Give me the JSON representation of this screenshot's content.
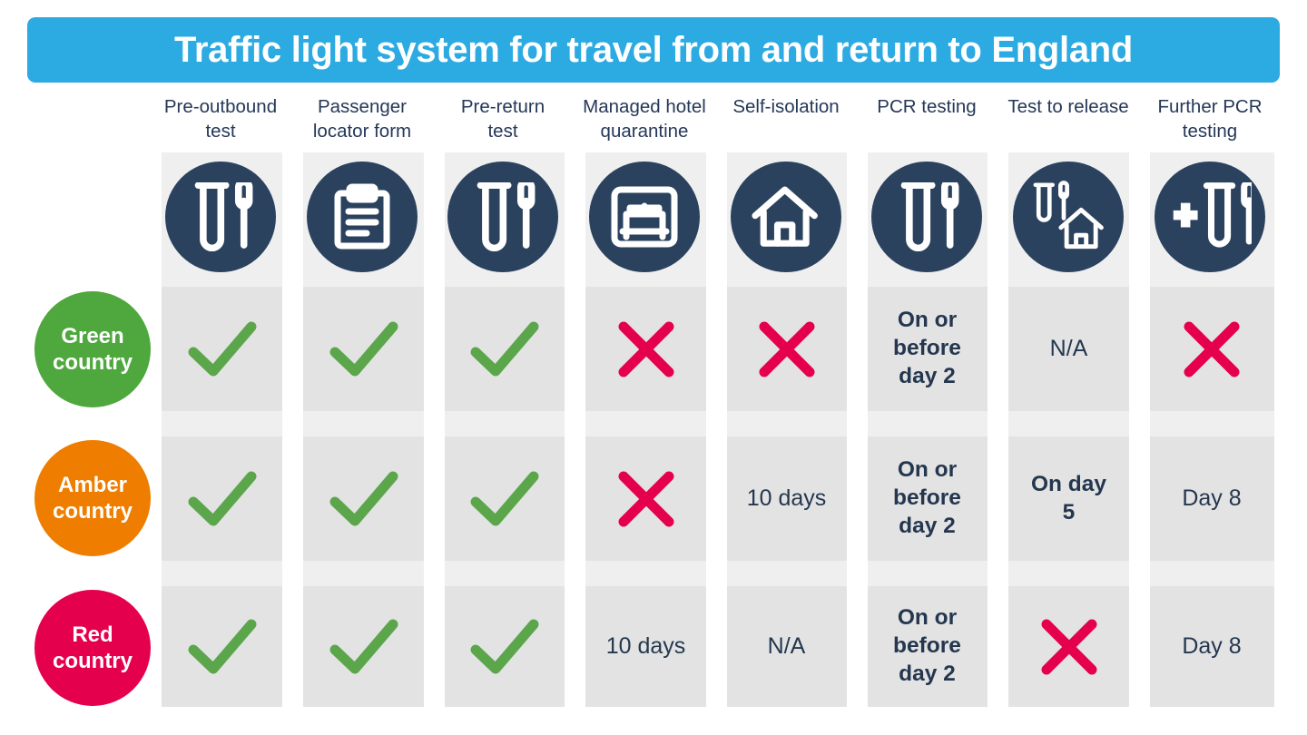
{
  "header": {
    "title": "Traffic light system for travel from and return to England",
    "title_bar_color": "#2CAAE2"
  },
  "colors": {
    "icon_circle": "#2B425F",
    "green": "#4FA83D",
    "amber": "#EE7D00",
    "red": "#E5004E",
    "check": "#5BA64B",
    "cross": "#E5004E",
    "cell_band": "#e3e3e3",
    "column_band": "#efefef",
    "text": "#24374F"
  },
  "columns": [
    {
      "label": "Pre-outbound\ntest",
      "line1": "Pre-outbound",
      "line2": "test",
      "icon": "test-tube-swab-icon"
    },
    {
      "label": "Passenger\nlocator form",
      "line1": "Passenger",
      "line2": "locator form",
      "icon": "clipboard-icon"
    },
    {
      "label": "Pre-return\ntest",
      "line1": "Pre-return",
      "line2": "test",
      "icon": "test-tube-swab-icon"
    },
    {
      "label": "Managed hotel\nquarantine",
      "line1": "Managed hotel",
      "line2": "quarantine",
      "icon": "hotel-bed-icon"
    },
    {
      "label": "Self-isolation",
      "line1": "Self-isolation",
      "line2": "",
      "icon": "house-icon"
    },
    {
      "label": "PCR testing",
      "line1": "PCR testing",
      "line2": "",
      "icon": "test-tube-swab-icon"
    },
    {
      "label": "Test to release",
      "line1": "Test to release",
      "line2": "",
      "icon": "test-tube-swab-house-icon"
    },
    {
      "label": "Further PCR\ntesting",
      "line1": "Further PCR",
      "line2": "testing",
      "icon": "plus-test-tube-swab-icon"
    }
  ],
  "rows": [
    {
      "name": "green",
      "label_line1": "Green",
      "label_line2": "country",
      "color": "#4FA83D",
      "cells": [
        {
          "type": "check",
          "text": ""
        },
        {
          "type": "check",
          "text": ""
        },
        {
          "type": "check",
          "text": ""
        },
        {
          "type": "cross",
          "text": ""
        },
        {
          "type": "cross",
          "text": ""
        },
        {
          "type": "text",
          "text": "On or\nbefore\nday 2",
          "weight": "bold"
        },
        {
          "type": "text",
          "text": "N/A",
          "weight": "light"
        },
        {
          "type": "cross",
          "text": ""
        }
      ]
    },
    {
      "name": "amber",
      "label_line1": "Amber",
      "label_line2": "country",
      "color": "#EE7D00",
      "cells": [
        {
          "type": "check",
          "text": ""
        },
        {
          "type": "check",
          "text": ""
        },
        {
          "type": "check",
          "text": ""
        },
        {
          "type": "cross",
          "text": ""
        },
        {
          "type": "text",
          "text": "10 days",
          "weight": "light"
        },
        {
          "type": "text",
          "text": "On or\nbefore\nday 2",
          "weight": "bold"
        },
        {
          "type": "text",
          "text": "On day\n5",
          "weight": "bold"
        },
        {
          "type": "text",
          "text": "Day 8",
          "weight": "light"
        }
      ]
    },
    {
      "name": "red",
      "label_line1": "Red",
      "label_line2": "country",
      "color": "#E5004E",
      "cells": [
        {
          "type": "check",
          "text": ""
        },
        {
          "type": "check",
          "text": ""
        },
        {
          "type": "check",
          "text": ""
        },
        {
          "type": "text",
          "text": "10 days",
          "weight": "light"
        },
        {
          "type": "text",
          "text": "N/A",
          "weight": "light"
        },
        {
          "type": "text",
          "text": "On or\nbefore\nday 2",
          "weight": "bold"
        },
        {
          "type": "cross",
          "text": ""
        },
        {
          "type": "text",
          "text": "Day 8",
          "weight": "light"
        }
      ]
    }
  ]
}
